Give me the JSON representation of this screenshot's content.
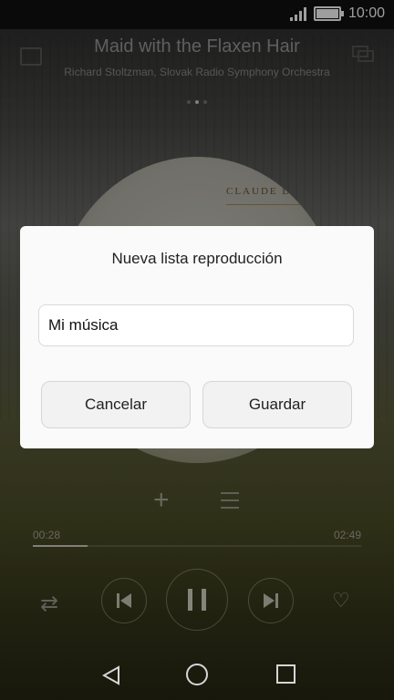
{
  "status_bar": {
    "time": "10:00"
  },
  "player": {
    "track_title": "Maid with the Flaxen Hair",
    "artist": "Richard Stoltzman, Slovak Radio Symphony Orchestra",
    "album_text": "CLAUDE DE",
    "elapsed": "00:28",
    "total": "02:49",
    "progress": 0.166
  },
  "dialog": {
    "title": "Nueva lista reproducción",
    "input_value": "Mi música",
    "cancel_label": "Cancelar",
    "save_label": "Guardar"
  },
  "colors": {
    "dialog_bg": "#fafafa",
    "overlay": "rgba(0,0,0,0.38)",
    "player_bg_bottom": "#4b4d26"
  },
  "icons": [
    "signal-icon",
    "battery-icon",
    "playlist-icon",
    "cast-icon",
    "add-icon",
    "queue-icon",
    "shuffle-icon",
    "previous-icon",
    "pause-icon",
    "next-icon",
    "heart-icon",
    "back-icon",
    "home-icon",
    "recent-apps-icon"
  ]
}
